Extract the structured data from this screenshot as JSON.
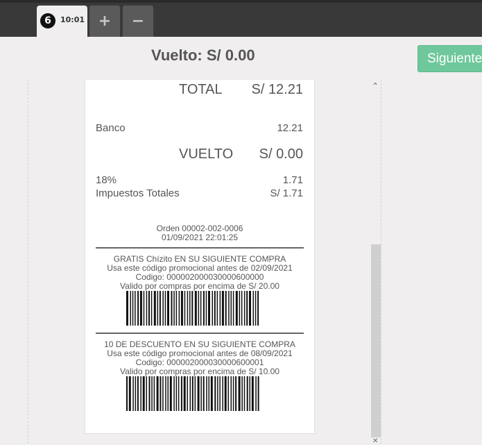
{
  "tabs": {
    "order_number": "6",
    "order_time": "10:01",
    "add_label": "+",
    "remove_label": "−"
  },
  "header": {
    "change_text": "Vuelto: S/ 0.00",
    "next_label": "Siguiente"
  },
  "receipt": {
    "total_label": "TOTAL",
    "total_value": "S/ 12.21",
    "payment_label": "Banco",
    "payment_value": "12.21",
    "change_label": "VUELTO",
    "change_value": "S/ 0.00",
    "tax_label": "18%",
    "tax_value": "1.71",
    "total_taxes_label": "Impuestos Totales",
    "total_taxes_value": "S/ 1.71",
    "order_ref": "Orden 00002-002-0006",
    "order_datetime": "01/09/2021 22:01:25",
    "coupons": [
      {
        "title": "GRATIS Chízito EN SU SIGUIENTE COMPRA",
        "valid_before": "Usa este código promocional antes de 02/09/2021",
        "code": "Codigo: 000002000030000600000",
        "min_purchase": "Valido por compras por encima de S/ 20.00"
      },
      {
        "title": "10 DE DESCUENTO EN SU SIGUIENTE COMPRA",
        "valid_before": "Usa este código promocional antes de 08/09/2021",
        "code": "Codigo: 000002000030000600001",
        "min_purchase": "Valido por compras por encima de S/ 10.00"
      }
    ]
  },
  "icons": {
    "scroll_up": "chevron-up-icon",
    "scroll_down": "chevron-down-icon"
  }
}
